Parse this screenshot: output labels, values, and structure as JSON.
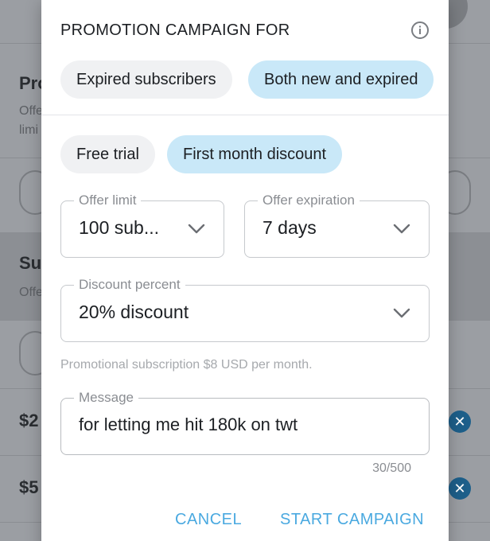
{
  "background": {
    "sections": [
      {
        "heading": "Pro",
        "sub_lines": [
          "Offe",
          "limi"
        ]
      },
      {
        "heading": "Su",
        "sub_lines": [
          "Offe"
        ]
      }
    ],
    "prices": [
      "$2",
      "$5"
    ]
  },
  "modal": {
    "title": "PROMOTION CAMPAIGN FOR",
    "audience_chips": [
      {
        "label": "Expired subscribers",
        "selected": false
      },
      {
        "label": "Both new and expired",
        "selected": true
      }
    ],
    "type_chips": [
      {
        "label": "Free trial",
        "selected": false
      },
      {
        "label": "First month discount",
        "selected": true
      }
    ],
    "offer_limit": {
      "label": "Offer limit",
      "value": "100 sub..."
    },
    "offer_expiration": {
      "label": "Offer expiration",
      "value": "7 days"
    },
    "discount_percent": {
      "label": "Discount percent",
      "value": "20% discount"
    },
    "helper_text": "Promotional subscription $8 USD per month.",
    "message": {
      "label": "Message",
      "value": "for letting me hit 180k on twt",
      "counter": "30/500"
    },
    "cancel_label": "CANCEL",
    "start_label": "START CAMPAIGN"
  },
  "colors": {
    "accent": "#4aa9e0",
    "chip_selected": "#c9e8f8",
    "chip_default": "#f0f1f3"
  }
}
